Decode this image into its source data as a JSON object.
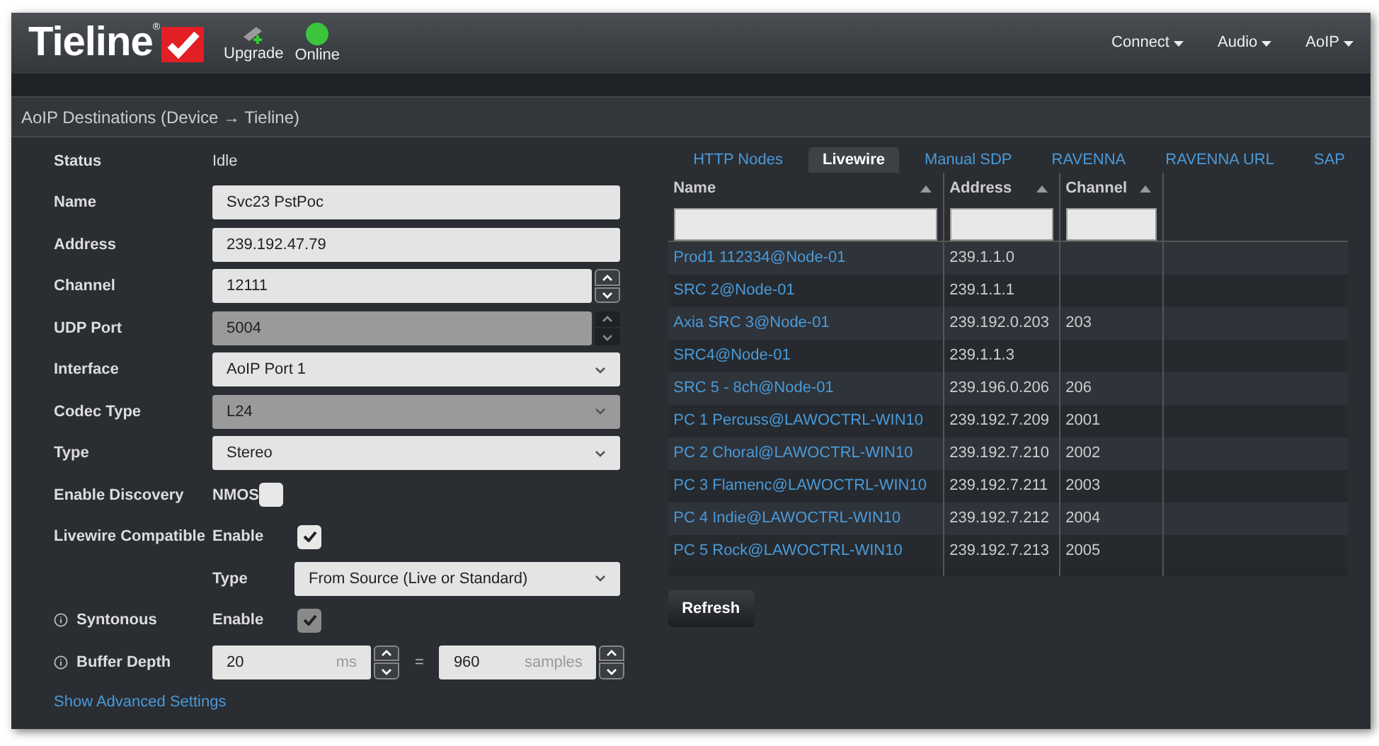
{
  "header": {
    "logo": "Tieline",
    "registered": "®",
    "tools": [
      {
        "kind": "upgrade",
        "label": "Upgrade"
      },
      {
        "kind": "status",
        "label": "Online",
        "color": "#3cc43c"
      }
    ],
    "nav": [
      {
        "label": "Connect"
      },
      {
        "label": "Audio"
      },
      {
        "label": "AoIP"
      }
    ]
  },
  "panel": {
    "title": "AoIP Destinations (Device → Tieline)"
  },
  "form": {
    "rows": [
      {
        "kind": "static",
        "label": "Status",
        "value": "Idle"
      },
      {
        "kind": "input",
        "label": "Name",
        "value": "Svc23 PstPoc"
      },
      {
        "kind": "input",
        "label": "Address",
        "value": "239.192.47.79"
      },
      {
        "kind": "number",
        "label": "Channel",
        "value": "12111",
        "disabled": false
      },
      {
        "kind": "number",
        "label": "UDP Port",
        "value": "5004",
        "disabled": true
      },
      {
        "kind": "select",
        "label": "Interface",
        "value": "AoIP Port 1",
        "disabled": false
      },
      {
        "kind": "select",
        "label": "Codec Type",
        "value": "L24",
        "disabled": true
      },
      {
        "kind": "select",
        "label": "Type",
        "value": "Stereo",
        "disabled": false
      },
      {
        "kind": "checkbox",
        "label": "Enable Discovery",
        "option": "NMOS",
        "checked": false,
        "disabled": false
      },
      {
        "kind": "checkbox",
        "label": "Livewire Compatible",
        "option": "Enable",
        "checked": true,
        "disabled": false
      },
      {
        "kind": "subselect",
        "sublabel": "Type",
        "value": "From Source (Live or Standard)"
      },
      {
        "kind": "checkbox",
        "label": "Syntonous",
        "info": true,
        "option": "Enable",
        "checked": true,
        "disabled": true
      },
      {
        "kind": "buffer",
        "label": "Buffer Depth",
        "info": true,
        "value": "20",
        "unit": "ms",
        "equals": "=",
        "value2": "960",
        "unit2": "samples"
      }
    ],
    "advanced_link": "Show Advanced Settings"
  },
  "sources": {
    "tabs": [
      {
        "label": "HTTP Nodes",
        "selected": false
      },
      {
        "label": "Livewire",
        "selected": true
      },
      {
        "label": "Manual SDP",
        "selected": false
      },
      {
        "label": "RAVENNA",
        "selected": false
      },
      {
        "label": "RAVENNA URL",
        "selected": false
      },
      {
        "label": "SAP",
        "selected": false
      }
    ],
    "columns": [
      "Name",
      "Address",
      "Channel"
    ],
    "rows": [
      {
        "name": "Prod1 112334@Node-01",
        "address": "239.1.1.0"
      },
      {
        "name": "SRC 2@Node-01",
        "address": "239.1.1.1"
      },
      {
        "name": "Axia SRC 3@Node-01",
        "address": "239.192.0.203",
        "channel": "203"
      },
      {
        "name": "SRC4@Node-01",
        "address": "239.1.1.3"
      },
      {
        "name": "SRC 5 - 8ch@Node-01",
        "address": "239.196.0.206",
        "channel": "206"
      },
      {
        "name": "PC 1 Percuss@LAWOCTRL-WIN10",
        "address": "239.192.7.209",
        "channel": "2001"
      },
      {
        "name": "PC 2 Choral@LAWOCTRL-WIN10",
        "address": "239.192.7.210",
        "channel": "2002"
      },
      {
        "name": "PC 3 Flamenc@LAWOCTRL-WIN10",
        "address": "239.192.7.211",
        "channel": "2003"
      },
      {
        "name": "PC 4 Indie@LAWOCTRL-WIN10",
        "address": "239.192.7.212",
        "channel": "2004"
      },
      {
        "name": "PC 5 Rock@LAWOCTRL-WIN10",
        "address": "239.192.7.213",
        "channel": "2005"
      }
    ],
    "refresh": "Refresh"
  }
}
